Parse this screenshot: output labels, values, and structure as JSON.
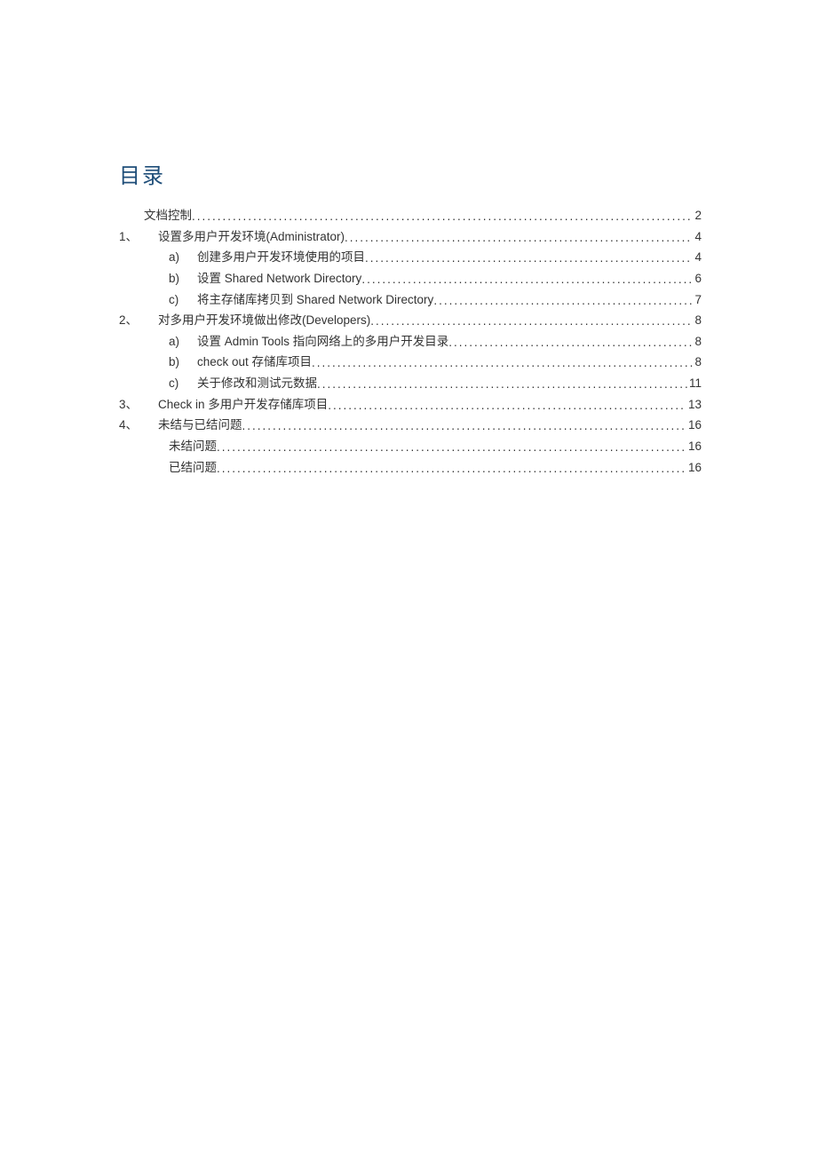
{
  "title": "目录",
  "entries": [
    {
      "indent": "indent-0",
      "prefix": "",
      "sub": "",
      "text": "文档控制",
      "page": "2"
    },
    {
      "indent": "indent-1",
      "prefix": "1、",
      "sub": "",
      "text": "设置多用户开发环境(Administrator)",
      "page": "4"
    },
    {
      "indent": "indent-2",
      "prefix": "",
      "sub": "a)",
      "text": "创建多用户开发环境使用的项目",
      "page": "4"
    },
    {
      "indent": "indent-2",
      "prefix": "",
      "sub": "b)",
      "text": "设置 Shared Network Directory ",
      "page": "6"
    },
    {
      "indent": "indent-2",
      "prefix": "",
      "sub": "c)",
      "text": "将主存储库拷贝到 Shared Network Directory",
      "page": "7"
    },
    {
      "indent": "indent-1",
      "prefix": "2、",
      "sub": "",
      "text": "对多用户开发环境做出修改(Developers)",
      "page": "8"
    },
    {
      "indent": "indent-2",
      "prefix": "",
      "sub": "a)",
      "text": "设置 Admin Tools 指向网络上的多用户开发目录",
      "page": "8"
    },
    {
      "indent": "indent-2",
      "prefix": "",
      "sub": "b)",
      "text": "check out 存储库项目",
      "page": "8"
    },
    {
      "indent": "indent-2",
      "prefix": "",
      "sub": "c)",
      "text": "关于修改和测试元数据",
      "page": "11"
    },
    {
      "indent": "indent-1",
      "prefix": "3、",
      "sub": "",
      "text": "Check in 多用户开发存储库项目 ",
      "page": "13"
    },
    {
      "indent": "indent-1",
      "prefix": "4、",
      "sub": "",
      "text": "未结与已结问题 ",
      "page": "16"
    },
    {
      "indent": "indent-sub",
      "prefix": "",
      "sub": "",
      "text": "未结问题 ",
      "page": "16"
    },
    {
      "indent": "indent-sub",
      "prefix": "",
      "sub": "",
      "text": "已结问题 ",
      "page": "16"
    }
  ]
}
